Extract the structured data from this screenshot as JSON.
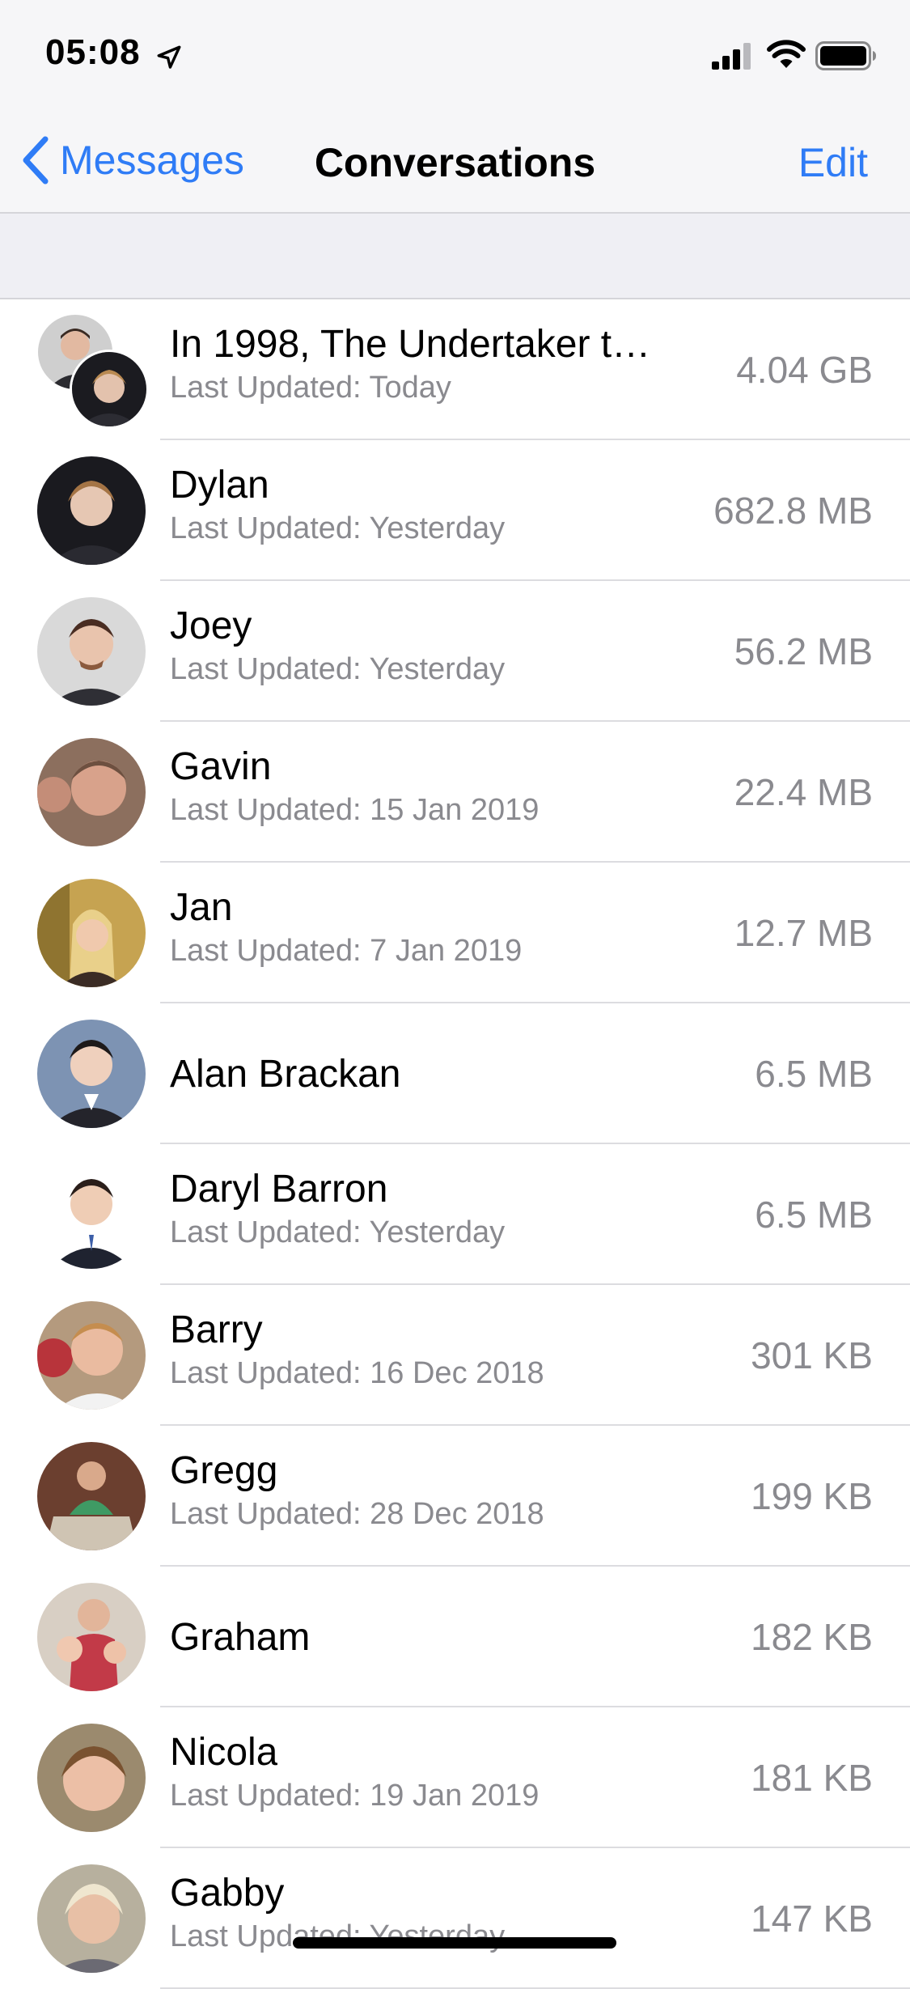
{
  "status_bar": {
    "time": "05:08",
    "location_icon": "location-arrow-icon",
    "signal_icon": "cellular-signal-icon",
    "wifi_icon": "wifi-icon",
    "battery_icon": "battery-icon"
  },
  "nav": {
    "back_label": "Messages",
    "back_icon": "chevron-left-icon",
    "title": "Conversations",
    "edit_label": "Edit"
  },
  "colors": {
    "accent": "#2f7cf6",
    "secondary_text": "#8a8a8f",
    "background": "#efeff4"
  },
  "conversations": [
    {
      "name": "In 1998, The Undertaker t…",
      "subtitle": "Last Updated: Today",
      "size": "4.04 GB",
      "avatar": "group-avatar"
    },
    {
      "name": "Dylan",
      "subtitle": "Last Updated: Yesterday",
      "size": "682.8 MB",
      "avatar": "contact-photo"
    },
    {
      "name": "Joey",
      "subtitle": "Last Updated: Yesterday",
      "size": "56.2 MB",
      "avatar": "contact-photo"
    },
    {
      "name": "Gavin",
      "subtitle": "Last Updated: 15 Jan 2019",
      "size": "22.4 MB",
      "avatar": "contact-photo"
    },
    {
      "name": "Jan",
      "subtitle": "Last Updated: 7 Jan 2019",
      "size": "12.7 MB",
      "avatar": "contact-photo"
    },
    {
      "name": "Alan Brackan",
      "subtitle": "",
      "size": "6.5 MB",
      "avatar": "contact-photo"
    },
    {
      "name": "Daryl Barron",
      "subtitle": "Last Updated: Yesterday",
      "size": "6.5 MB",
      "avatar": "contact-photo"
    },
    {
      "name": "Barry",
      "subtitle": "Last Updated: 16 Dec 2018",
      "size": "301 KB",
      "avatar": "contact-photo"
    },
    {
      "name": "Gregg",
      "subtitle": "Last Updated: 28 Dec 2018",
      "size": "199 KB",
      "avatar": "contact-photo"
    },
    {
      "name": "Graham",
      "subtitle": "",
      "size": "182 KB",
      "avatar": "contact-photo"
    },
    {
      "name": "Nicola",
      "subtitle": "Last Updated: 19 Jan 2019",
      "size": "181 KB",
      "avatar": "contact-photo"
    },
    {
      "name": "Gabby",
      "subtitle": "Last Updated: Yesterday",
      "size": "147 KB",
      "avatar": "contact-photo"
    }
  ]
}
